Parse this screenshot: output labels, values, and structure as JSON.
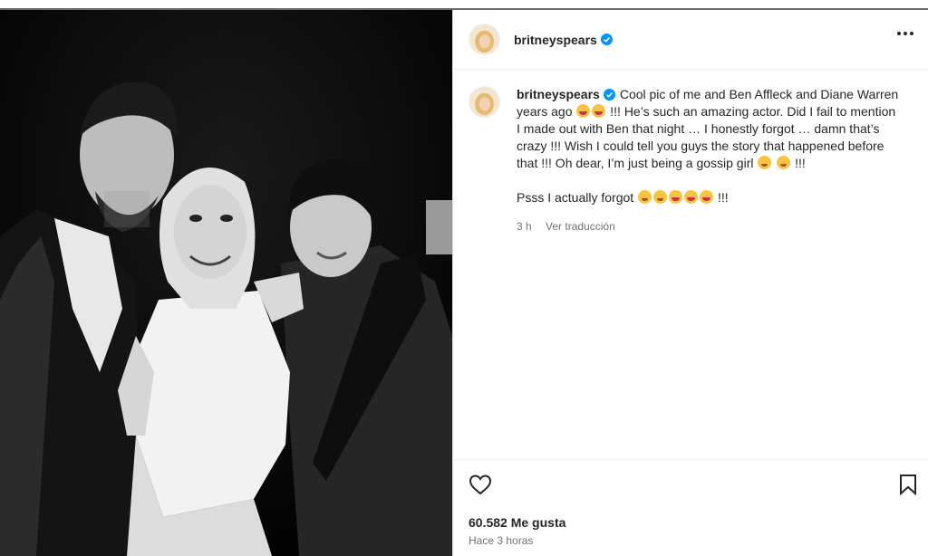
{
  "post": {
    "username": "britneyspears",
    "verified": true,
    "caption_paragraphs": [
      "Cool pic of me and Ben Affleck and Diane Warren years ago",
      "!!! He’s such an amazing actor. Did I fail to mention I made out with Ben that night … I honestly forgot … damn that’s crazy !!! Wish I could tell you guys the story that happened before that !!! Oh dear, I’m just being a gossip girl",
      "!!!",
      "Psss I actually forgot",
      "!!!"
    ],
    "time": "3 h",
    "translate_label": "Ver traducción",
    "likes": "60.582 Me gusta",
    "posted_ago": "Hace 3 horas"
  },
  "icons": {
    "more": "more-options-icon",
    "heart": "heart-icon",
    "bookmark": "bookmark-icon",
    "verified": "verified-badge-icon"
  },
  "colors": {
    "verified_blue": "#0095f6",
    "text": "#262626",
    "secondary": "#737373"
  }
}
